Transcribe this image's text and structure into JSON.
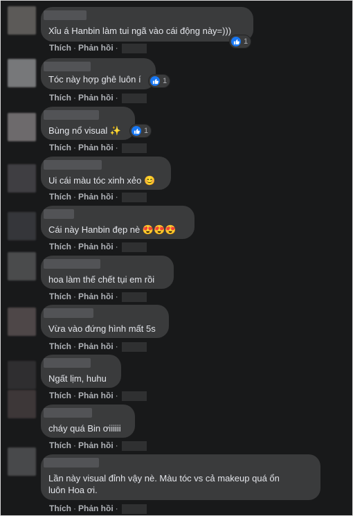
{
  "actions": {
    "like_label": "Thích",
    "reply_label": "Phản hồi",
    "separator": "·"
  },
  "comments": [
    {
      "text": "Xỉu á Hanbin làm tui ngã vào cái động này=)))",
      "reactions": "1"
    },
    {
      "text": "Tóc này hợp ghê luôn í",
      "reactions": "1"
    },
    {
      "text": "Bùng nổ visual ✨",
      "reactions": "1"
    },
    {
      "text": "Ui cái màu tóc xinh xẻo 😊"
    },
    {
      "text": "Cái này Hanbin đẹp nè 😍😍😍"
    },
    {
      "text": "hoa làm thế chết tụi em rồi"
    },
    {
      "text": "Vừa vào đứng hình mất 5s"
    },
    {
      "text": "Ngất lịm, huhu"
    },
    {
      "text": "cháy quá Bin ơiiiiii"
    },
    {
      "text": "Lần này visual đỉnh vậy nè. Màu tóc vs cả makeup quá ổn\nluôn Hoa ơi."
    }
  ],
  "icons": {
    "like": "thumbs-up-icon"
  },
  "colors": {
    "background": "#18191a",
    "bubble": "#3a3b3c",
    "text": "#e4e6eb",
    "secondary_text": "#b0b3b8",
    "like_blue": "#1877f2"
  }
}
